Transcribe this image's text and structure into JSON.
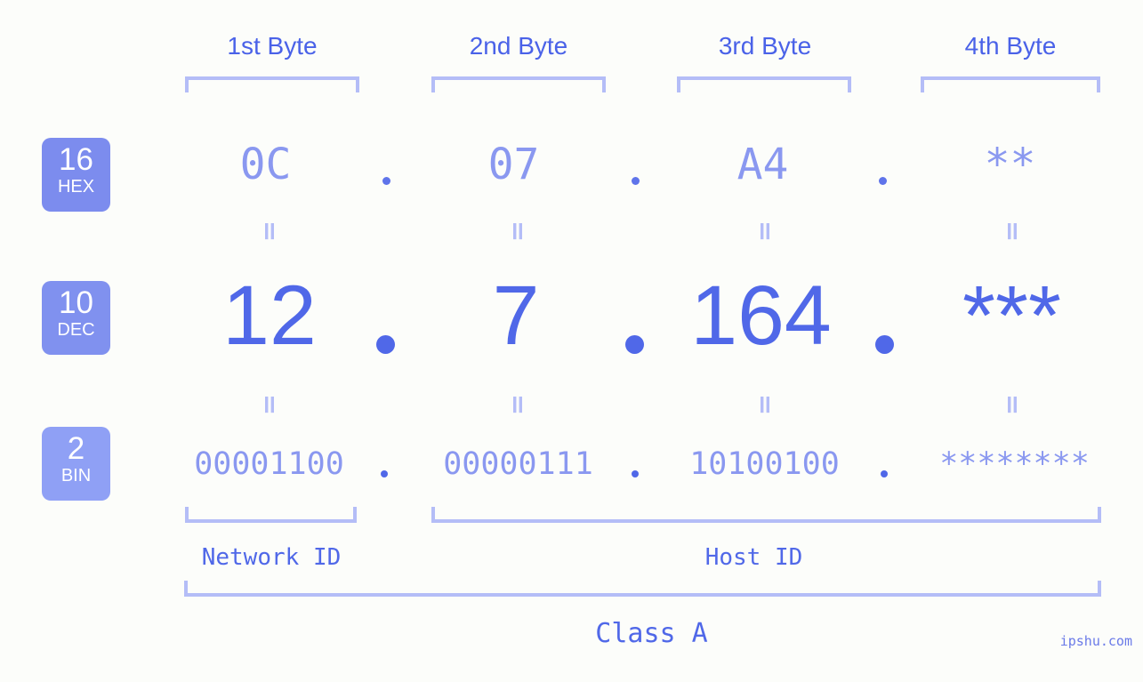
{
  "background_color": "#fcfdfa",
  "accent_strong": "#5068e8",
  "accent_mid": "#4a62e8",
  "accent_light": "#8a98f0",
  "bracket_color": "#b4bdf7",
  "headers": {
    "bytes": [
      {
        "label": "1st Byte"
      },
      {
        "label": "2nd Byte"
      },
      {
        "label": "3rd Byte"
      },
      {
        "label": "4th Byte"
      }
    ]
  },
  "radix_badges": [
    {
      "number": "16",
      "name": "HEX",
      "color": "#7c8cee"
    },
    {
      "number": "10",
      "name": "DEC",
      "color": "#8091ef"
    },
    {
      "number": "2",
      "name": "BIN",
      "color": "#8fa0f5"
    }
  ],
  "rows": {
    "hex": {
      "radix": "16",
      "radix_name": "HEX",
      "values": [
        "0C",
        "07",
        "A4",
        "**"
      ],
      "separator": "."
    },
    "dec": {
      "radix": "10",
      "radix_name": "DEC",
      "values": [
        "12",
        "7",
        "164",
        "***"
      ],
      "separator": "."
    },
    "bin": {
      "radix": "2",
      "radix_name": "BIN",
      "values": [
        "00001100",
        "00000111",
        "10100100",
        "********"
      ],
      "separator": "."
    }
  },
  "equality_symbol": "=",
  "sections": {
    "network_id": "Network ID",
    "host_id": "Host ID",
    "class": "Class A"
  },
  "watermark": "ipshu.com"
}
